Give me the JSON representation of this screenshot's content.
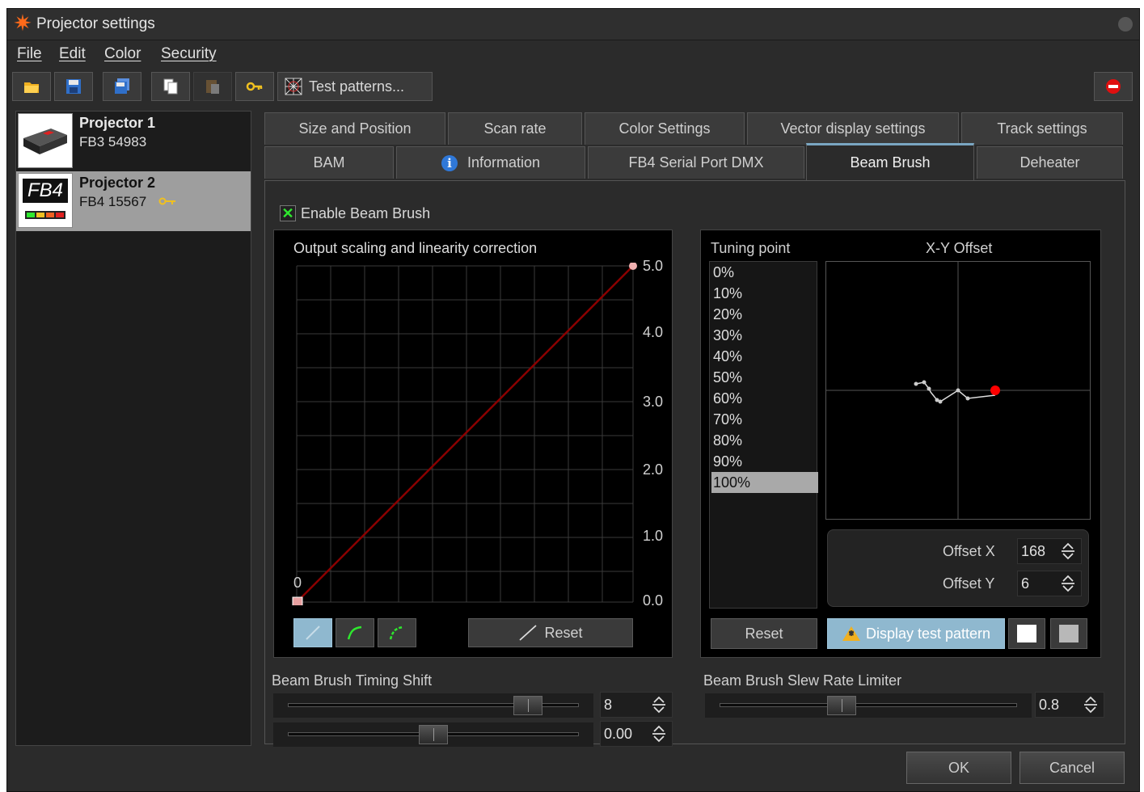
{
  "window": {
    "title": "Projector settings",
    "app_icon": "sun-icon"
  },
  "menu": {
    "file": "File",
    "edit": "Edit",
    "color": "Color",
    "security": "Security"
  },
  "toolbar": {
    "test_patterns": "Test patterns..."
  },
  "projectors": [
    {
      "name": "Projector 1",
      "serial": "FB3 54983"
    },
    {
      "name": "Projector 2",
      "serial": "FB4 15567",
      "thumb_text": "FB4"
    }
  ],
  "tabs": {
    "row1": [
      "Size and Position",
      "Scan rate",
      "Color Settings",
      "Vector display settings",
      "Track settings"
    ],
    "row2": [
      "BAM",
      "Information",
      "FB4 Serial Port DMX",
      "Beam Brush",
      "Deheater"
    ],
    "active": "Beam Brush"
  },
  "beam_brush": {
    "enable_label": "Enable Beam Brush",
    "enabled": true,
    "output_title": "Output scaling and linearity correction",
    "y_ticks": [
      "5.0",
      "4.0",
      "3.0",
      "2.0",
      "1.0",
      "0.0"
    ],
    "zero_label": "0",
    "reset_label": "Reset",
    "tuning_title": "Tuning point",
    "xy_title": "X-Y Offset",
    "tuning_points": [
      "0%",
      "10%",
      "20%",
      "30%",
      "40%",
      "50%",
      "60%",
      "70%",
      "80%",
      "90%",
      "100%"
    ],
    "selected_point": "100%",
    "offset_x_label": "Offset X",
    "offset_x": "168",
    "offset_y_label": "Offset Y",
    "offset_y": "6",
    "reset2_label": "Reset",
    "display_test_pattern": "Display test pattern",
    "timing_shift_label": "Beam Brush Timing Shift",
    "timing_shift_value": "8",
    "timing_shift_fraction": 0.86,
    "second_value": "0.00",
    "second_fraction": 0.5,
    "slew_label": "Beam Brush Slew Rate Limiter",
    "slew_value": "0.8",
    "slew_fraction": 0.4
  },
  "footer": {
    "ok": "OK",
    "cancel": "Cancel"
  },
  "colors": {
    "accent": "#8fb8cf",
    "curve": "#8b0000",
    "marker": "#ff0000"
  }
}
